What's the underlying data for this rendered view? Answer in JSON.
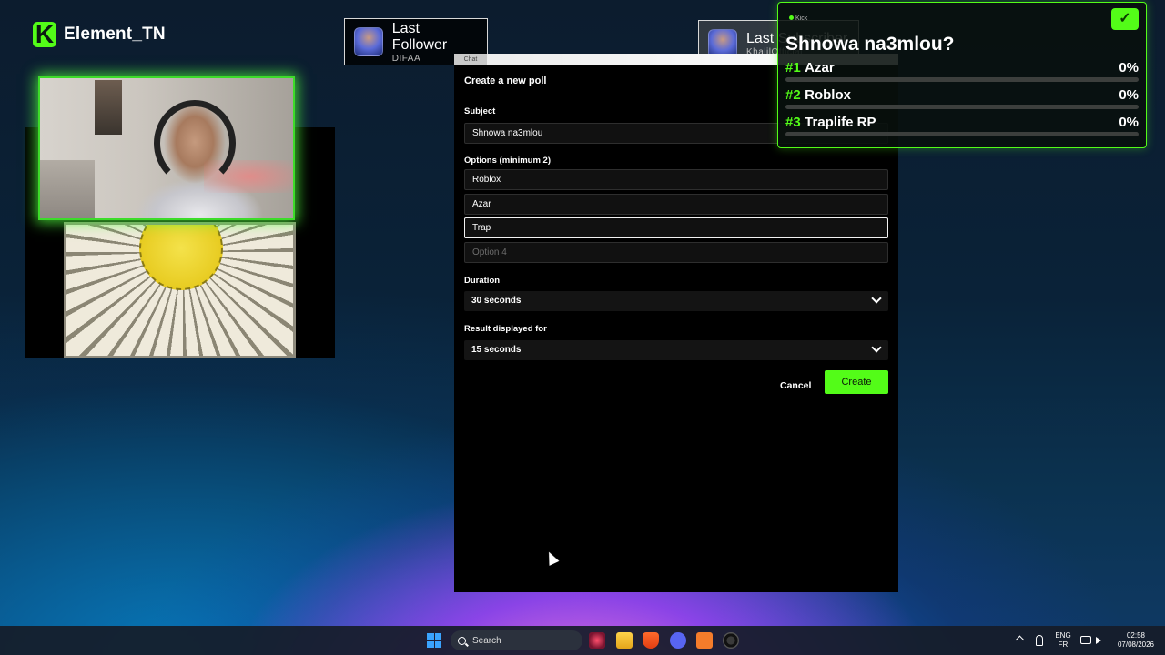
{
  "brand": {
    "name": "Element_TN",
    "logo_letter": "K",
    "accent": "#53fc18"
  },
  "alerts": {
    "follower": {
      "title": "Last Follower",
      "name": "DIFAA"
    },
    "subscriber": {
      "title": "Last Subscriber",
      "name": "KhalilOfficial"
    }
  },
  "poll_widget": {
    "platform": "Kick",
    "question": "Shnowa na3mlou?",
    "check_icon": "✓",
    "options": [
      {
        "rank": "#1",
        "label": "Azar",
        "percent_label": "0%",
        "percent": 0
      },
      {
        "rank": "#2",
        "label": "Roblox",
        "percent_label": "0%",
        "percent": 0
      },
      {
        "rank": "#3",
        "label": "Traplife RP",
        "percent_label": "0%",
        "percent": 0
      }
    ]
  },
  "modal": {
    "tab_label": "Chat",
    "title": "Create a new poll",
    "subject_label": "Subject",
    "subject_value": "Shnowa na3mlou",
    "options_label": "Options (minimum 2)",
    "options": [
      {
        "value": "Roblox",
        "placeholder": ""
      },
      {
        "value": "Azar",
        "placeholder": ""
      },
      {
        "value": "Trap",
        "placeholder": ""
      },
      {
        "value": "",
        "placeholder": "Option 4"
      }
    ],
    "duration_label": "Duration",
    "duration_value": "30 seconds",
    "result_label": "Result displayed for",
    "result_value": "15 seconds",
    "cancel_label": "Cancel",
    "create_label": "Create",
    "create_color": "#53fc18"
  },
  "taskbar": {
    "search_label": "Search",
    "lang_top": "ENG",
    "lang_bottom": "FR",
    "time": "02:58",
    "date": "07/08/2026",
    "apps": [
      "start-icon",
      "search-icon",
      "media-app-icon",
      "file-explorer-icon",
      "brave-browser-icon",
      "discord-icon",
      "xampp-icon",
      "obs-icon"
    ]
  }
}
